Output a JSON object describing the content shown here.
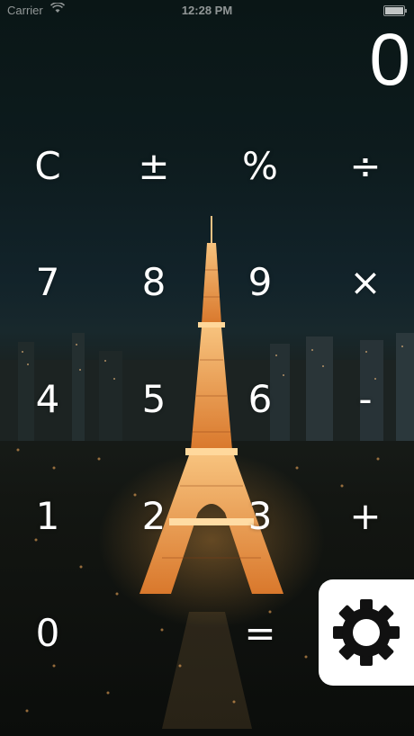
{
  "status_bar": {
    "carrier": "Carrier",
    "wifi": "wifi-icon",
    "time": "12:28 PM",
    "battery": "battery-icon"
  },
  "display": {
    "value": "0"
  },
  "keys": {
    "clear": "C",
    "plus_minus": "±",
    "percent": "%",
    "divide": "÷",
    "seven": "7",
    "eight": "8",
    "nine": "9",
    "multiply": "×",
    "four": "4",
    "five": "5",
    "six": "6",
    "minus": "-",
    "one": "1",
    "two": "2",
    "three": "3",
    "plus": "+",
    "zero": "0",
    "equals": "="
  },
  "settings": {
    "icon": "gear-icon"
  },
  "colors": {
    "text": "#ffffff",
    "settings_bg": "#ffffff",
    "gear": "#111111",
    "tower_glow": "#ffaa46"
  }
}
